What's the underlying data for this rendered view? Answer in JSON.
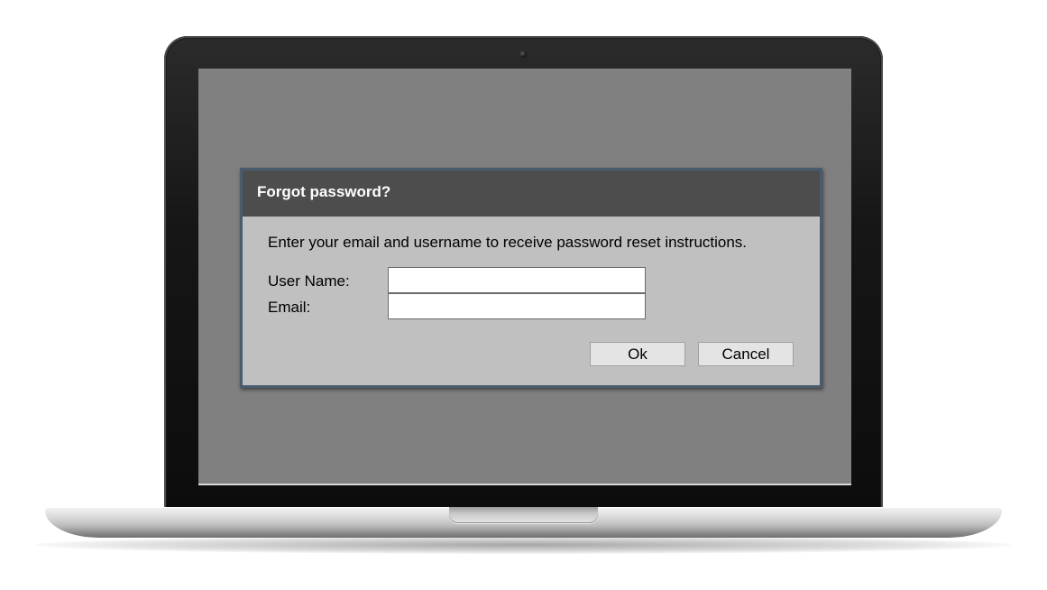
{
  "dialog": {
    "title": "Forgot password?",
    "message": "Enter your email and username to receive password reset instructions.",
    "username_label": "User Name:",
    "username_value": "",
    "email_label": "Email:",
    "email_value": "",
    "ok_label": "Ok",
    "cancel_label": "Cancel"
  },
  "colors": {
    "screen_background": "#808080",
    "dialog_header": "#4d4d4d",
    "dialog_body": "#c0c0c0",
    "dialog_border": "#4b5b6e"
  }
}
